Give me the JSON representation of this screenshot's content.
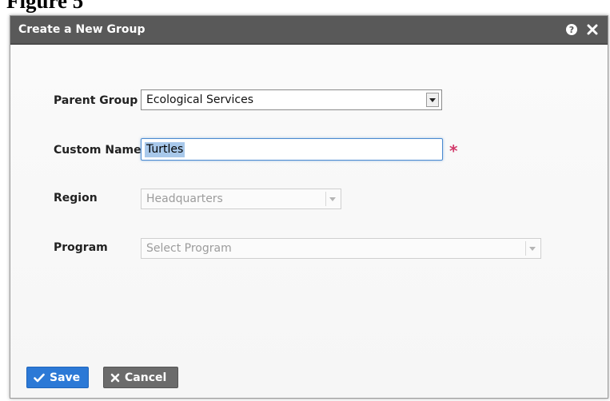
{
  "figure": {
    "caption": "Figure 5"
  },
  "dialog": {
    "title": "Create a New Group",
    "icons": {
      "help": "?",
      "close": "✖"
    }
  },
  "form": {
    "parent_group": {
      "label": "Parent Group",
      "value": "Ecological Services"
    },
    "custom_name": {
      "label": "Custom Name",
      "value": "Turtles",
      "required_mark": "*"
    },
    "region": {
      "label": "Region",
      "value": "Headquarters"
    },
    "program": {
      "label": "Program",
      "placeholder": "Select Program"
    }
  },
  "actions": {
    "save": {
      "label": "Save",
      "icon": "✔"
    },
    "cancel": {
      "label": "Cancel",
      "icon": "✖"
    }
  },
  "colors": {
    "titlebar": "#595959",
    "save_button": "#2c79d6",
    "cancel_button": "#6b6b6b",
    "required_asterisk": "#d23a6a",
    "text_selection": "#a8c8ea"
  }
}
